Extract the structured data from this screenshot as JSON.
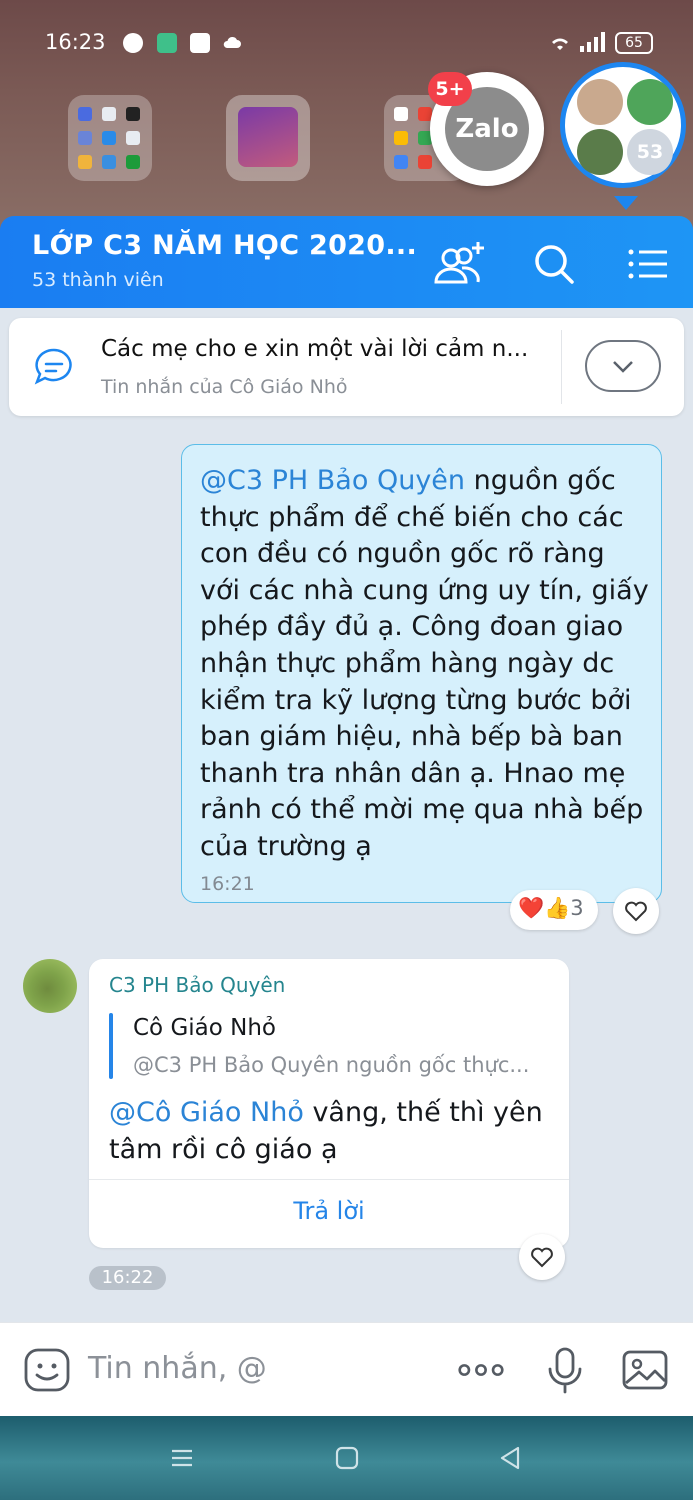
{
  "status_bar": {
    "time": "16:23",
    "battery": "65"
  },
  "floating": {
    "zalo_label": "Zalo",
    "zalo_badge": "5+",
    "group_member_count": "53"
  },
  "header": {
    "title": "LỚP C3 NĂM HỌC 2020...",
    "subtitle": "53 thành viên"
  },
  "pinned_message": {
    "text": "Các mẹ cho e xin một vài lời cảm n...",
    "from": "Tin nhắn của Cô Giáo Nhỏ"
  },
  "outgoing_message": {
    "mention": "@C3 PH Bảo Quyên",
    "text": " nguồn gốc thực phẩm để chế biến cho các con đều có nguồn gốc rõ ràng với các nhà cung ứng uy tín, giấy phép đầy đủ ạ. Công đoan giao nhận thực phẩm hàng ngày dc kiểm tra kỹ lượng từng bước bởi ban giám hiệu, nhà bếp bà ban thanh tra nhân dân ạ. Hnao mẹ rảnh có thể mời mẹ qua nhà bếp của trường ạ",
    "time": "16:21",
    "reactions": "❤️👍3"
  },
  "incoming_message": {
    "sender": "C3 PH Bảo Quyên",
    "quote_name": "Cô Giáo Nhỏ",
    "quote_text": "@C3 PH Bảo Quyên nguồn gốc thực...",
    "mention": "@Cô Giáo Nhỏ",
    "text": " vâng, thế thì yên tâm rồi cô giáo ạ",
    "reply_label": "Trả lời",
    "time": "16:22"
  },
  "input": {
    "placeholder": "Tin nhắn, @"
  },
  "colors": {
    "header": "#1a7df2",
    "mention": "#2b84d6",
    "outgoing_bg": "#d6f0fc"
  }
}
